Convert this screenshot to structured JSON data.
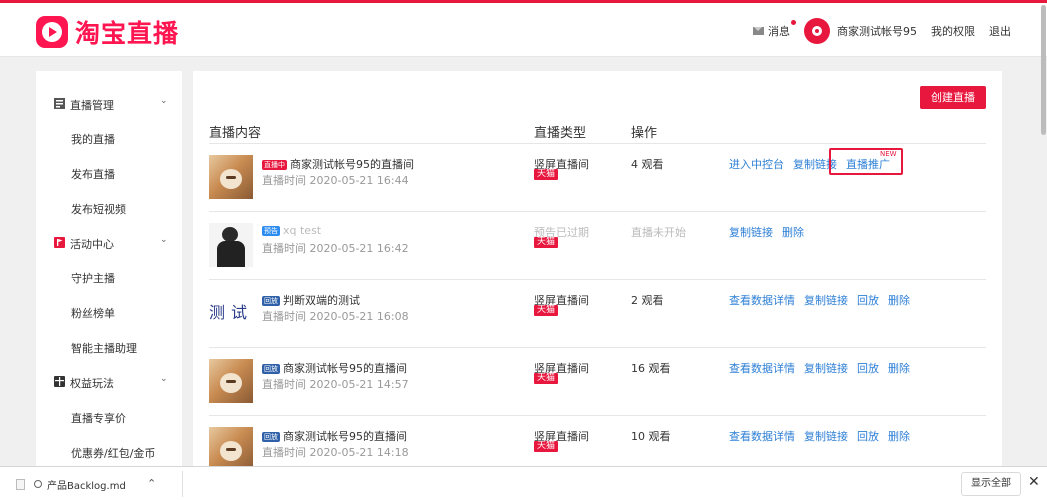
{
  "header": {
    "logo_text": "淘宝直播",
    "messages_label": "消息",
    "account_name": "商家测试帐号95",
    "permissions_label": "我的权限",
    "logout_label": "退出"
  },
  "sidebar": {
    "groups": [
      {
        "label": "直播管理",
        "icon": "broadcast-icon",
        "items": [
          "我的直播",
          "发布直播",
          "发布短视频"
        ]
      },
      {
        "label": "活动中心",
        "icon": "flag-icon",
        "items": [
          "守护主播",
          "粉丝榜单",
          "智能主播助理"
        ]
      },
      {
        "label": "权益玩法",
        "icon": "gift-icon",
        "items": [
          "直播专享价",
          "优惠券/红包/金币"
        ]
      }
    ]
  },
  "main": {
    "create_button": "创建直播",
    "columns": [
      "直播内容",
      "直播类型",
      "操作"
    ],
    "rows": [
      {
        "thumb": "cat",
        "tag": "直播中",
        "tag_kind": "live",
        "title": "商家测试帐号95的直播间",
        "time": "直播时间 2020-05-21 16:44",
        "type": "竖屏直播间",
        "platform": "天猫",
        "viewers": "4 观看",
        "actions": [
          "进入中控台",
          "复制链接",
          "直播推广"
        ],
        "new_badge": "NEW",
        "dim": false
      },
      {
        "thumb": "person",
        "tag": "预告",
        "tag_kind": "pre",
        "title": "xq test",
        "time": "直播时间 2020-05-21 16:42",
        "type": "预告已过期",
        "platform": "天猫",
        "viewers": "直播未开始",
        "actions": [
          "复制链接",
          "删除"
        ],
        "dim": true
      },
      {
        "thumb": "text",
        "thumb_text": "测试",
        "tag": "回放",
        "tag_kind": "rep",
        "title": "判断双端的测试",
        "time": "直播时间 2020-05-21 16:08",
        "type": "竖屏直播间",
        "platform": "天猫",
        "viewers": "2 观看",
        "actions": [
          "查看数据详情",
          "复制链接",
          "回放",
          "删除"
        ],
        "dim": false
      },
      {
        "thumb": "cat",
        "tag": "回放",
        "tag_kind": "rep",
        "title": "商家测试帐号95的直播间",
        "time": "直播时间 2020-05-21 14:57",
        "type": "竖屏直播间",
        "platform": "天猫",
        "viewers": "16 观看",
        "actions": [
          "查看数据详情",
          "复制链接",
          "回放",
          "删除"
        ],
        "dim": false
      },
      {
        "thumb": "cat",
        "tag": "回放",
        "tag_kind": "rep",
        "title": "商家测试帐号95的直播间",
        "time": "直播时间 2020-05-21 14:18",
        "type": "竖屏直播间",
        "platform": "天猫",
        "viewers": "10 观看",
        "actions": [
          "查看数据详情",
          "复制链接",
          "回放",
          "删除"
        ],
        "dim": false
      }
    ]
  },
  "download_bar": {
    "file_name": "产品Backlog.md",
    "show_all": "显示全部",
    "close_icon": "close-icon"
  },
  "colors": {
    "brand": "#e8173e",
    "link": "#2d7fd6"
  }
}
